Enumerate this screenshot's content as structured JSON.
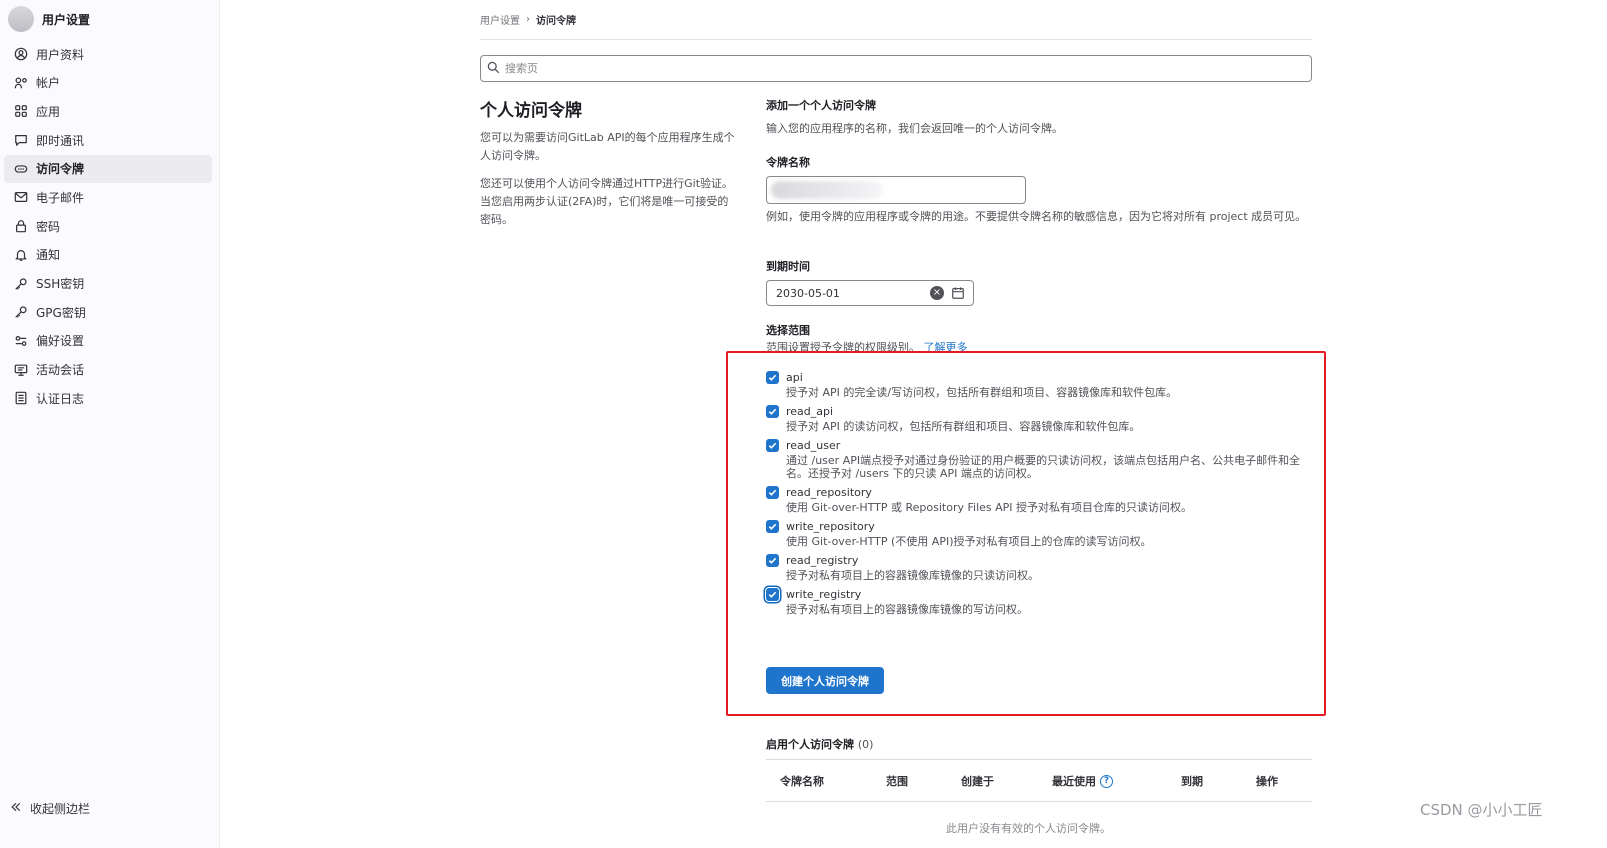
{
  "sidebar": {
    "title": "用户设置",
    "items": [
      {
        "label": "用户资料",
        "icon": "profile-icon"
      },
      {
        "label": "帐户",
        "icon": "account-icon"
      },
      {
        "label": "应用",
        "icon": "applications-icon"
      },
      {
        "label": "即时通讯",
        "icon": "chat-icon"
      },
      {
        "label": "访问令牌",
        "icon": "token-icon",
        "active": true
      },
      {
        "label": "电子邮件",
        "icon": "mail-icon"
      },
      {
        "label": "密码",
        "icon": "lock-icon"
      },
      {
        "label": "通知",
        "icon": "bell-icon"
      },
      {
        "label": "SSH密钥",
        "icon": "key-icon"
      },
      {
        "label": "GPG密钥",
        "icon": "key-icon"
      },
      {
        "label": "偏好设置",
        "icon": "preferences-icon"
      },
      {
        "label": "活动会话",
        "icon": "monitor-icon"
      },
      {
        "label": "认证日志",
        "icon": "log-icon"
      }
    ],
    "collapse_label": "收起侧边栏"
  },
  "breadcrumb": {
    "parent": "用户设置",
    "current": "访问令牌"
  },
  "search": {
    "placeholder": "搜索页"
  },
  "intro": {
    "title": "个人访问令牌",
    "desc1": "您可以为需要访问GitLab API的每个应用程序生成个人访问令牌。",
    "desc2": "您还可以使用个人访问令牌通过HTTP进行Git验证。 当您启用两步认证(2FA)时，它们将是唯一可接受的密码。"
  },
  "form": {
    "heading": "添加一个个人访问令牌",
    "heading_desc": "输入您的应用程序的名称，我们会返回唯一的个人访问令牌。",
    "name_label": "令牌名称",
    "name_help": "例如，使用令牌的应用程序或令牌的用途。不要提供令牌名称的敏感信息，因为它将对所有 project 成员可见。",
    "expiry_label": "到期时间",
    "expiry_value": "2030-05-01",
    "scope_label": "选择范围",
    "scope_help": "范围设置授予令牌的权限级别。",
    "scope_help_link": "了解更多",
    "scopes": [
      {
        "name": "api",
        "desc": "授予对 API 的完全读/写访问权，包括所有群组和项目、容器镜像库和软件包库。",
        "checked": true
      },
      {
        "name": "read_api",
        "desc": "授予对 API 的读访问权，包括所有群组和项目、容器镜像库和软件包库。",
        "checked": true
      },
      {
        "name": "read_user",
        "desc": "通过 /user API端点授予对通过身份验证的用户概要的只读访问权，该端点包括用户名、公共电子邮件和全名。还授予对 /users 下的只读 API 端点的访问权。",
        "checked": true
      },
      {
        "name": "read_repository",
        "desc": "使用 Git-over-HTTP 或 Repository Files API 授予对私有项目仓库的只读访问权。",
        "checked": true
      },
      {
        "name": "write_repository",
        "desc": "使用 Git-over-HTTP (不使用 API)授予对私有项目上的仓库的读写访问权。",
        "checked": true
      },
      {
        "name": "read_registry",
        "desc": "授予对私有项目上的容器镜像库镜像的只读访问权。",
        "checked": true
      },
      {
        "name": "write_registry",
        "desc": "授予对私有项目上的容器镜像库镜像的写访问权。",
        "checked": true
      }
    ],
    "submit_label": "创建个人访问令牌"
  },
  "active_tokens": {
    "title": "启用个人访问令牌",
    "count": "(0)",
    "columns": [
      "令牌名称",
      "范围",
      "创建于",
      "最近使用",
      "到期",
      "操作"
    ],
    "empty_text": "此用户没有有效的个人访问令牌。"
  },
  "watermark": "CSDN @小小工匠",
  "colors": {
    "accent": "#1f75cb",
    "highlight_box": "#e41b24",
    "active_nav_bg": "#ececef"
  }
}
